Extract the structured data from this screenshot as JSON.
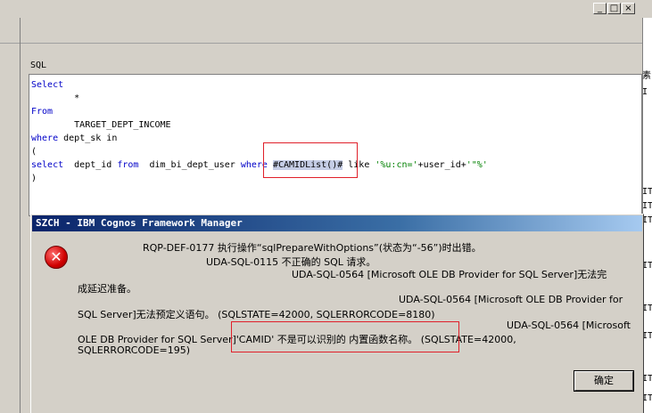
{
  "window_controls": {
    "minimize": "_",
    "maximize": "□",
    "close": "×"
  },
  "sql_label": "SQL",
  "sql_lines": [
    {
      "kw": "Select",
      "rest": ""
    },
    {
      "kw": "",
      "rest": "        *"
    },
    {
      "kw": "From",
      "rest": ""
    },
    {
      "kw": "",
      "rest": "        TARGET_DEPT_INCOME"
    },
    {
      "kw": "where",
      "rest": " dept_sk in"
    },
    {
      "kw": "",
      "rest": "("
    }
  ],
  "sql_line7": {
    "select": "select",
    "part1": "  dept_id ",
    "from": "from",
    "part2": "  dim_bi_dept_user ",
    "where": "where",
    "space": " ",
    "camid": "#CAMIDList()#",
    "like": " like ",
    "str1": "'%u:cn='",
    "plus": "+user_id+",
    "str2": "'\"%'"
  },
  "sql_line8": ")",
  "right_pane": [
    "素",
    "I",
    "IT",
    "IT",
    "IT",
    "IT",
    "IT",
    "IT",
    "IT",
    "IT"
  ],
  "dialog": {
    "title": "SZCH - IBM Cognos Framework Manager",
    "icon": "✕",
    "lines": [
      "RQP-DEF-0177 执行操作“sqlPrepareWithOptions”(状态为“-56”)时出错。",
      "UDA-SQL-0115 不正确的 SQL 请求。",
      "UDA-SQL-0564 [Microsoft OLE DB Provider for SQL Server]无法完",
      "成延迟准备。",
      "UDA-SQL-0564 [Microsoft OLE DB Provider for",
      "SQL Server]无法预定义语句。 (SQLSTATE=42000, SQLERRORCODE=8180)",
      "UDA-SQL-0564 [Microsoft",
      "OLE DB Provider for SQL Server]'CAMID' 不是可以识别的 内置函数名称。 (SQLSTATE=42000,",
      "SQLERRORCODE=195)"
    ],
    "ok_button": "确定"
  }
}
